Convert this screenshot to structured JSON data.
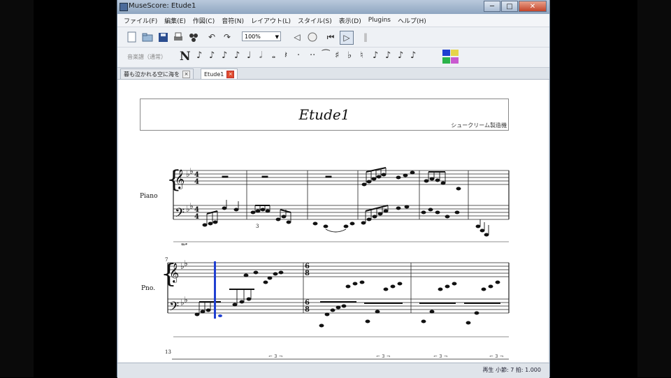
{
  "window": {
    "title": "MuseScore: Etude1",
    "buttons": {
      "minimize": "─",
      "maximize": "□",
      "close": "✕"
    }
  },
  "menu": [
    "ファイル(F)",
    "編集(E)",
    "作図(C)",
    "音符(N)",
    "レイアウト(L)",
    "スタイル(S)",
    "表示(D)",
    "Plugins",
    "ヘルプ(H)"
  ],
  "toolbar": {
    "zoom": "100%",
    "note_entry_label": "音楽譜（通常）",
    "note_mode": "N"
  },
  "tabs": [
    {
      "label": "暮も泣かれる空に海を",
      "active": false
    },
    {
      "label": "Etude1",
      "active": true
    }
  ],
  "score": {
    "title": "Etude1",
    "composer": "シュークリーム製造機",
    "instrument_full": "Piano",
    "instrument_short": "Pno.",
    "measure_number_2": "7",
    "measure_number_3": "13",
    "triplet": "3"
  },
  "status": {
    "text": "再生 小節: 7 拍: 1.000"
  },
  "colors": {
    "cursor": "#1f3fd1",
    "titlebar": "#a6b8cf",
    "close": "#c4452a"
  }
}
